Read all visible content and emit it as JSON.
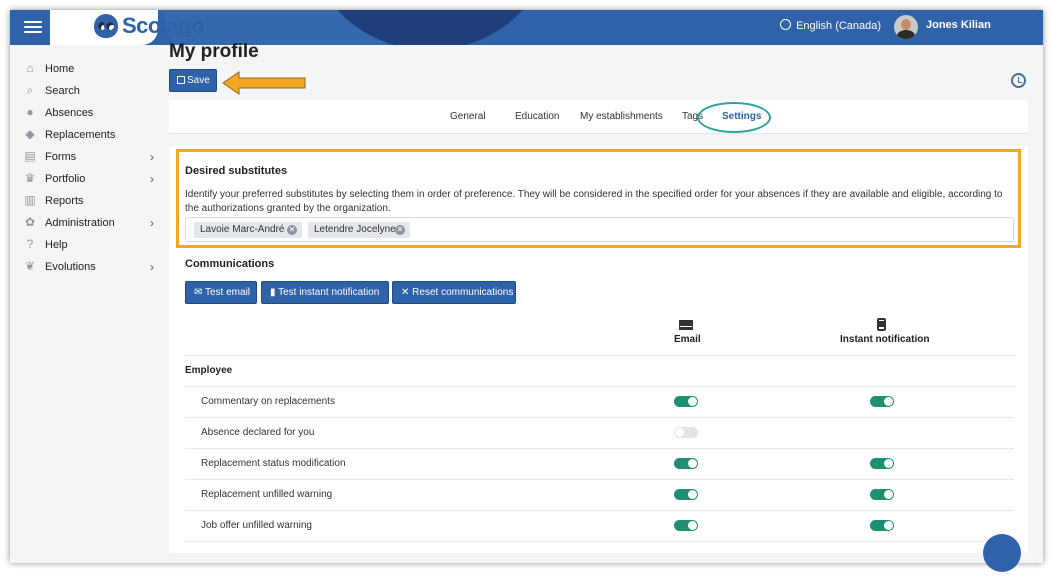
{
  "app": {
    "logo_text": "Scolago",
    "language": "English (Canada)",
    "user_name": "Jones Kilian"
  },
  "sidebar": {
    "items": [
      {
        "label": "Home",
        "icon": "home-icon"
      },
      {
        "label": "Search",
        "icon": "search-icon"
      },
      {
        "label": "Absences",
        "icon": "absences-icon"
      },
      {
        "label": "Replacements",
        "icon": "replacements-icon"
      },
      {
        "label": "Forms",
        "icon": "forms-icon"
      },
      {
        "label": "Portfolio",
        "icon": "trophy-icon"
      },
      {
        "label": "Reports",
        "icon": "reports-icon"
      },
      {
        "label": "Administration",
        "icon": "gear-icon"
      },
      {
        "label": "Help",
        "icon": "question-icon"
      },
      {
        "label": "Evolutions",
        "icon": "sprout-icon"
      }
    ]
  },
  "page": {
    "title": "My profile",
    "save_label": "Save"
  },
  "tabs": [
    "General",
    "Education",
    "My establishments",
    "Tags",
    "Settings"
  ],
  "substitutes": {
    "heading": "Desired substitutes",
    "description": "Identify your preferred substitutes by selecting them in order of preference. They will be considered in the specified order for your absences if they are available and eligible, according to the authorizations granted by the organization.",
    "chips": [
      "Lavoie Marc-André",
      "Letendre Jocelyne"
    ]
  },
  "communications": {
    "heading": "Communications",
    "buttons": [
      "Test email",
      "Test instant notification",
      "Reset communications"
    ],
    "col_email": "Email",
    "col_instant": "Instant notification",
    "section": "Employee",
    "rows": [
      {
        "label": "Commentary on replacements",
        "email": true,
        "instant": true
      },
      {
        "label": "Absence declared for you",
        "email": false,
        "instant": null
      },
      {
        "label": "Replacement status modification",
        "email": true,
        "instant": true
      },
      {
        "label": "Replacement unfilled warning",
        "email": true,
        "instant": true
      },
      {
        "label": "Job offer unfilled warning",
        "email": true,
        "instant": true
      }
    ]
  },
  "colors": {
    "brand": "#2f62a8",
    "toggle_on": "#1e8f72",
    "highlight": "#f5a623",
    "ring": "#2fa29a"
  }
}
